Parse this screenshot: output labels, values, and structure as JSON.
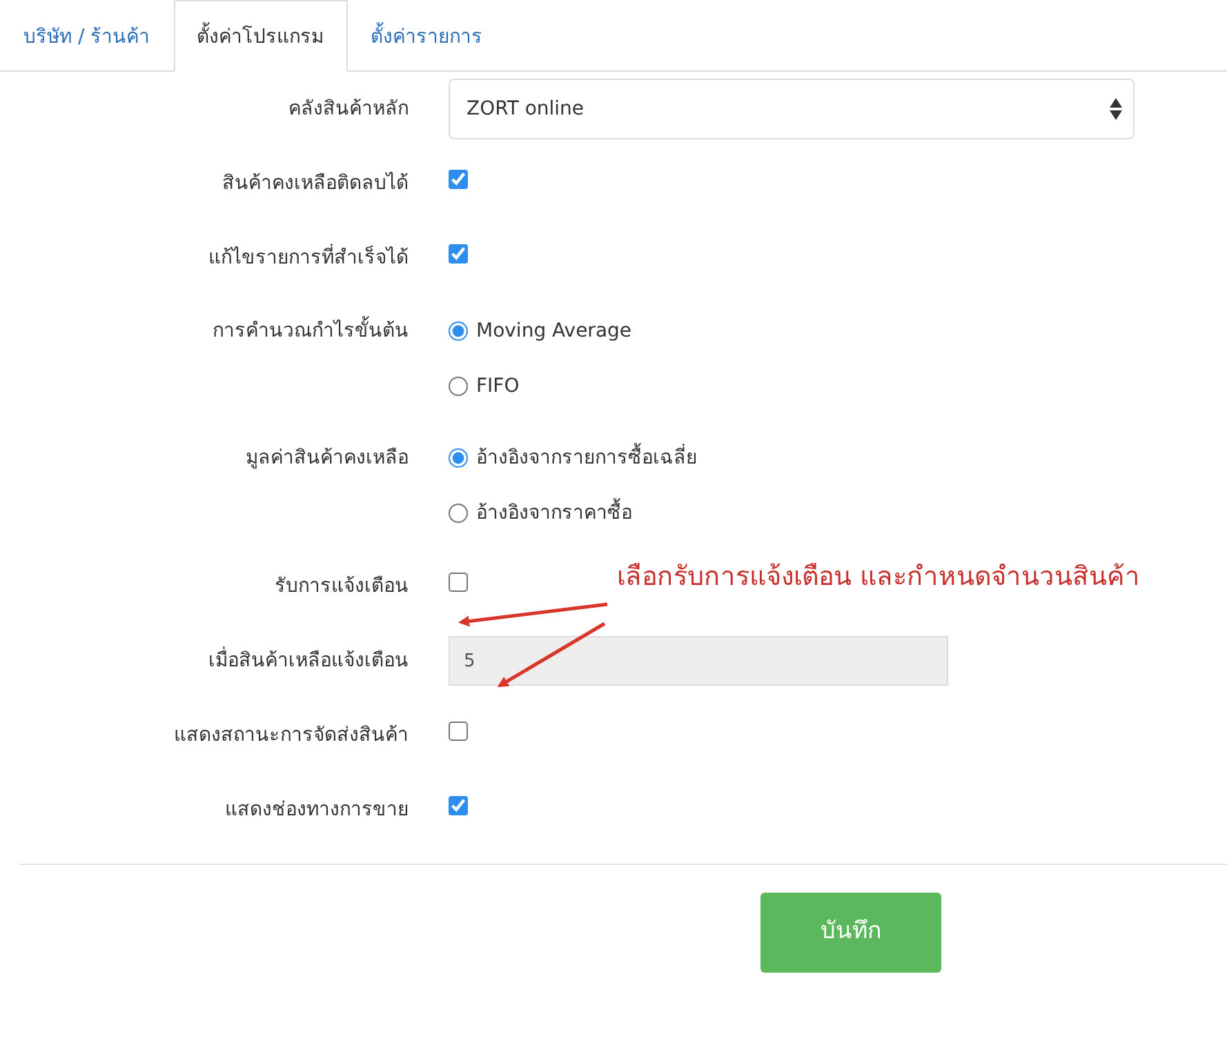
{
  "tabs": [
    {
      "label": "บริษัท / ร้านค้า",
      "selected": false
    },
    {
      "label": "ตั้งค่าโปรแกรม",
      "selected": true
    },
    {
      "label": "ตั้งค่ารายการ",
      "selected": false
    }
  ],
  "fields": [
    {
      "label": "คลังสินค้าหลัก",
      "kind": "select",
      "value": "ZORT online"
    },
    {
      "label": "สินค้าคงเหลือติดลบได้",
      "kind": "checkbox",
      "checked": true
    },
    {
      "label": "แก้ไขรายการที่สำเร็จได้",
      "kind": "checkbox",
      "checked": true
    },
    {
      "label": "การคำนวณกำไรขั้นต้น",
      "kind": "radio",
      "options": [
        {
          "label": "Moving Average",
          "selected": true
        },
        {
          "label": "FIFO",
          "selected": false
        }
      ]
    },
    {
      "label": "มูลค่าสินค้าคงเหลือ",
      "kind": "radio",
      "options": [
        {
          "label": "อ้างอิงจากรายการซื้อเฉลี่ย",
          "selected": true
        },
        {
          "label": "อ้างอิงจากราคาซื้อ",
          "selected": false
        }
      ]
    },
    {
      "label": "รับการแจ้งเตือน",
      "kind": "checkbox",
      "checked": false
    },
    {
      "label": "เมื่อสินค้าเหลือแจ้งเตือน",
      "kind": "number",
      "value": "5",
      "disabled": true
    },
    {
      "label": "แสดงสถานะการจัดส่งสินค้า",
      "kind": "checkbox",
      "checked": false
    },
    {
      "label": "แสดงช่องทางการขาย",
      "kind": "checkbox",
      "checked": true
    }
  ],
  "annotation": {
    "text": "เลือกรับการแจ้งเตือน และกำหนดจำนวนสินค้า"
  },
  "save_button": "บันทึก"
}
